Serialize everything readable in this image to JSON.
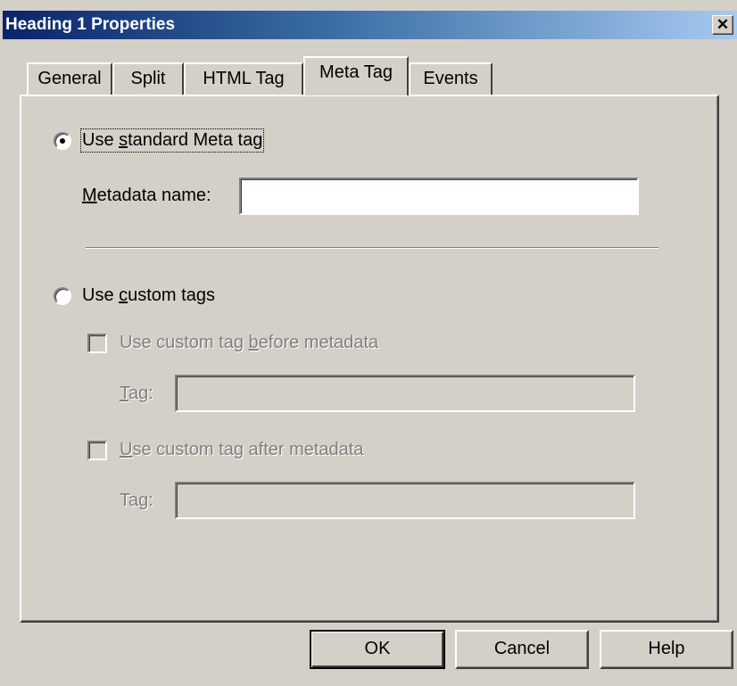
{
  "window": {
    "title": "Heading 1 Properties",
    "close_glyph": "✕"
  },
  "tabs": [
    {
      "label": "General",
      "active": false
    },
    {
      "label": "Split",
      "active": false
    },
    {
      "label": "HTML Tag",
      "active": false
    },
    {
      "label": "Meta Tag",
      "active": true
    },
    {
      "label": "Events",
      "active": false
    }
  ],
  "standard": {
    "radio_label_pre": "Use ",
    "radio_label_key": "s",
    "radio_label_post": "tandard Meta tag",
    "selected": true,
    "name_label_key": "M",
    "name_label_post": "etadata name:",
    "name_value": ""
  },
  "custom": {
    "radio_label_pre": "Use ",
    "radio_label_key": "c",
    "radio_label_post": "ustom tags",
    "selected": false,
    "before_label_pre": "Use custom tag ",
    "before_label_key": "b",
    "before_label_post": "efore metadata",
    "before_checked": false,
    "tag1_label_key": "T",
    "tag1_label_post": "ag:",
    "tag1_value": "",
    "after_label_key": "U",
    "after_label_post": "se custom tag after metadata",
    "after_checked": false,
    "tag2_label": "Tag:",
    "tag2_value": ""
  },
  "buttons": {
    "ok": "OK",
    "cancel": "Cancel",
    "help": "Help"
  },
  "colors": {
    "face": "#d4d0c8",
    "title_start": "#0a246a",
    "title_end": "#a6caf0",
    "disabled_text": "#808080"
  }
}
